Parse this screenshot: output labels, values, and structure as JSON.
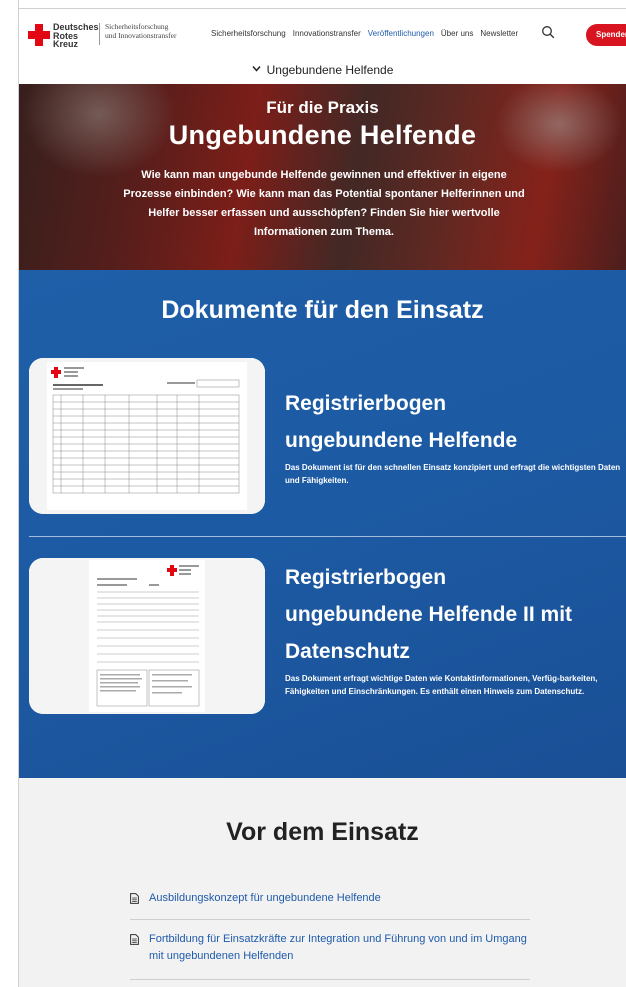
{
  "header": {
    "logo_lines": [
      "Deutsches",
      "Rotes",
      "Kreuz"
    ],
    "tagline_lines": [
      "Sicherheitsforschung",
      "und Innovationstransfer"
    ],
    "nav": [
      {
        "label": "Sicherheitsforschung",
        "active": false
      },
      {
        "label": "Innovationstransfer",
        "active": false
      },
      {
        "label": "Veröffentlichungen",
        "active": true
      },
      {
        "label": "Über uns",
        "active": false
      },
      {
        "label": "Newsletter",
        "active": false
      }
    ],
    "search_icon": "search-icon",
    "donate_label": "Spenden"
  },
  "subnav": {
    "label": "Ungebundene Helfende",
    "icon": "chevron-down-icon"
  },
  "hero": {
    "kicker": "Für die Praxis",
    "title": "Ungebundene Helfende",
    "text": "Wie kann man ungebunde Helfende gewinnen und effektiver in eigene Prozesse einbinden? Wie kann man das Potential spontaner Helferinnen und Helfer besser erfassen und ausschöpfen? Finden Sie hier wertvolle Informationen zum Thema."
  },
  "documents": {
    "title": "Dokumente für den Einsatz",
    "items": [
      {
        "title_lines": [
          "Registrierbogen",
          "ungebundene Helfende"
        ],
        "description": "Das Dokument ist für den schnellen Einsatz konzipiert und erfragt die wichtigsten Daten und Fähigkeiten."
      },
      {
        "title_lines": [
          "Registrierbogen",
          "ungebundene Helfende II mit",
          "Datenschutz"
        ],
        "description": "Das Dokument erfragt wichtige Daten wie Kontaktinformationen, Verfüg-barkeiten, Fähigkeiten und Einschränkungen. Es enthält einen Hinweis zum Datenschutz."
      }
    ]
  },
  "before": {
    "title": "Vor dem Einsatz",
    "links": [
      {
        "label": "Ausbildungskonzept für ungebundene Helfende",
        "icon": "document-icon"
      },
      {
        "label": "Fortbildung für Einsatzkräfte zur Integration und Führung von und im Umgang mit ungebundenen Helfenden",
        "icon": "document-icon"
      }
    ]
  },
  "colors": {
    "brand_red": "#e30613",
    "link_blue": "#1f5bab",
    "section_blue": "#1c5aa3"
  }
}
